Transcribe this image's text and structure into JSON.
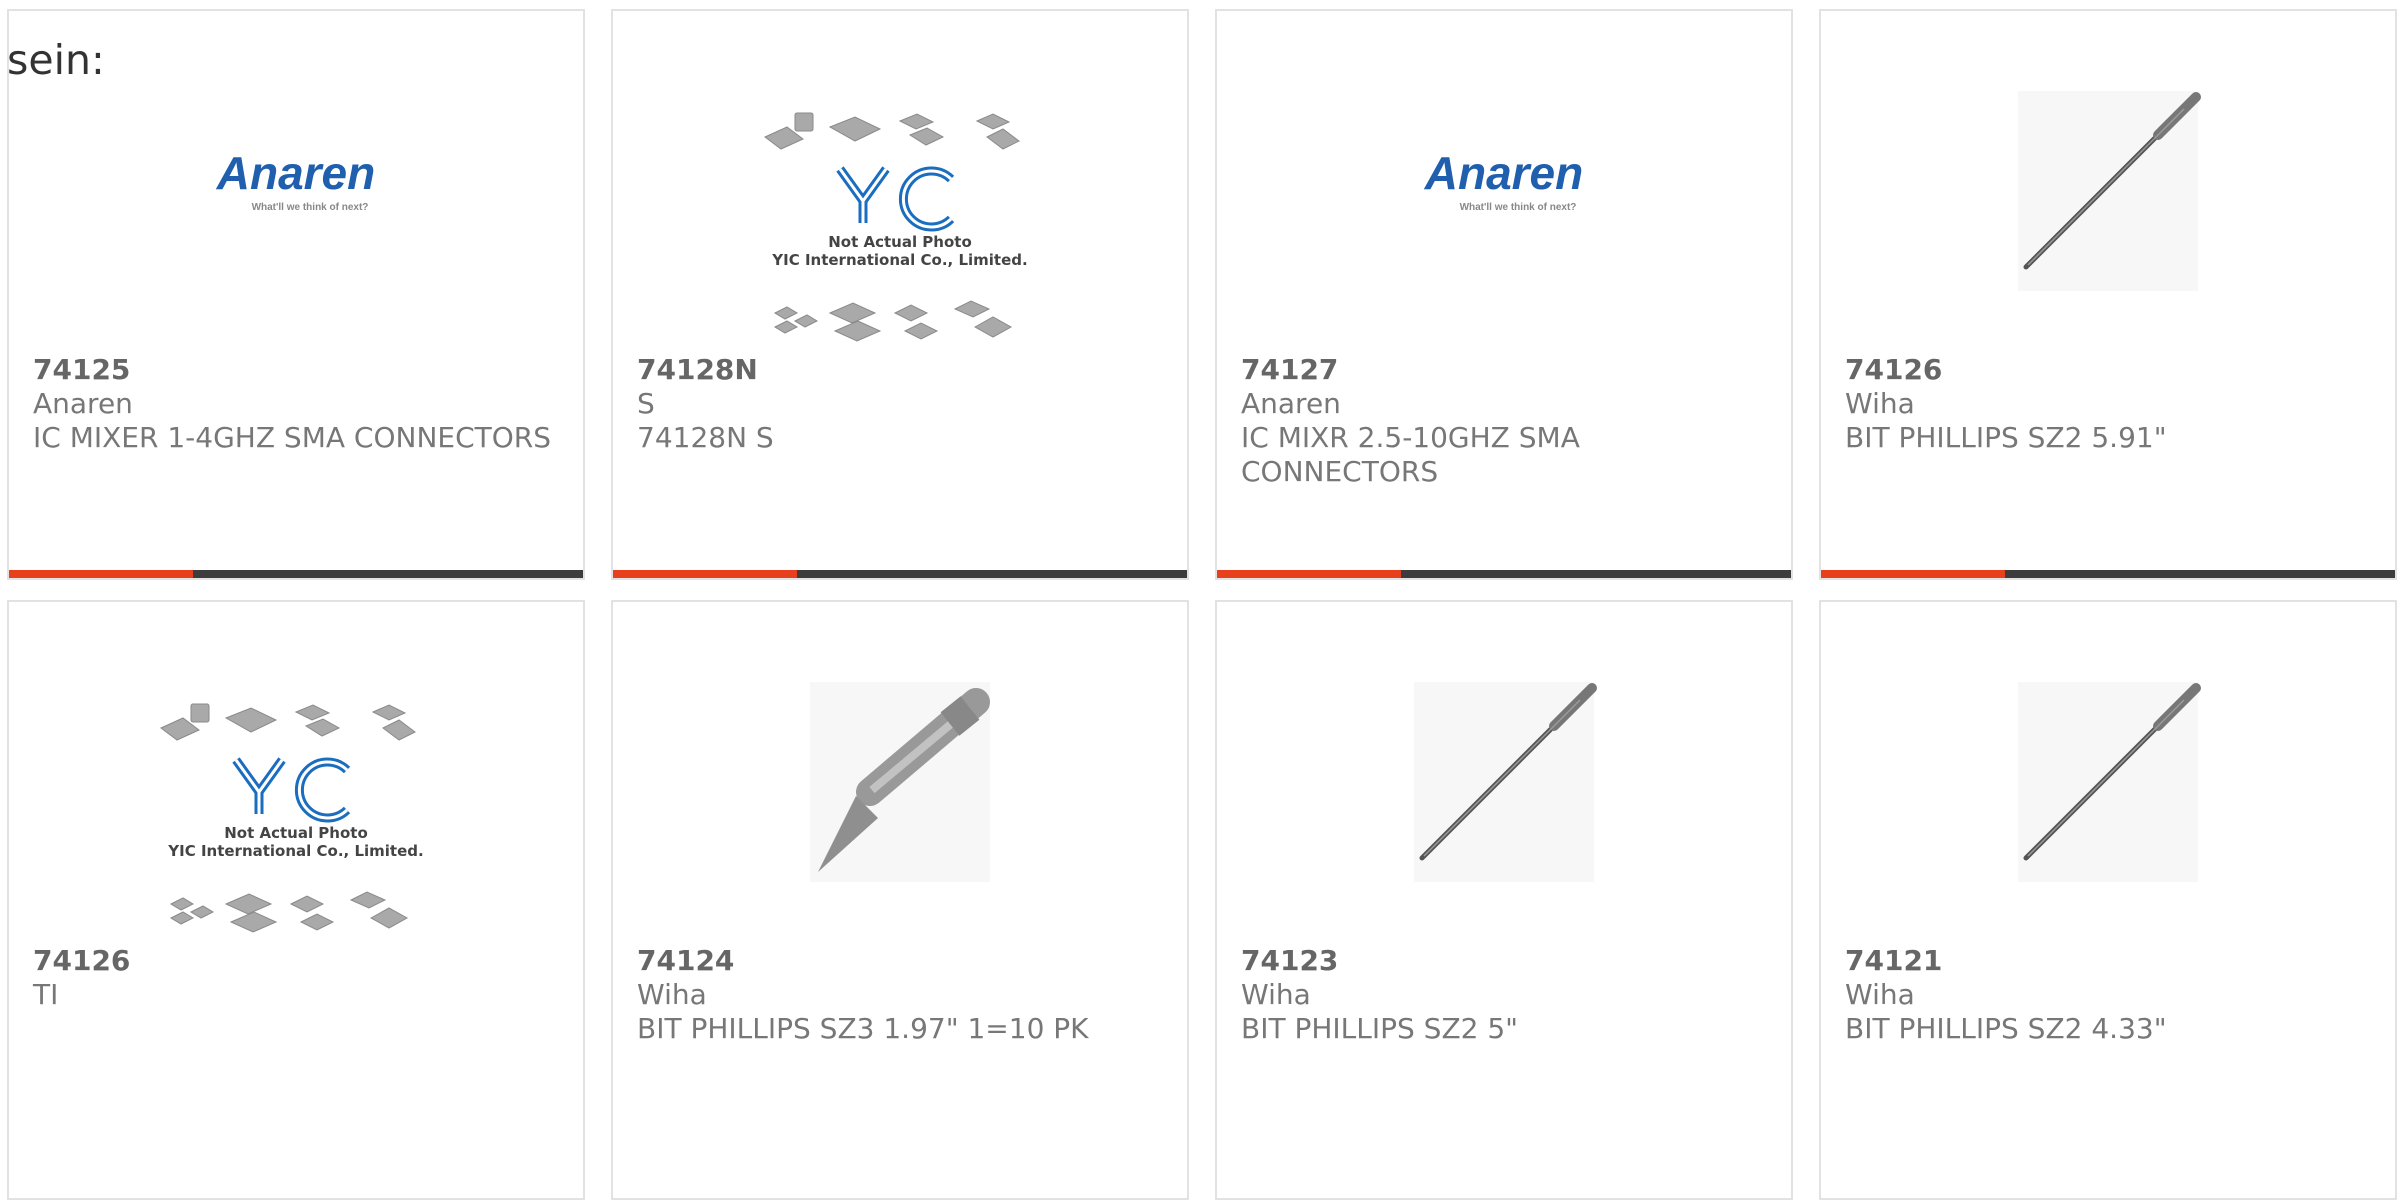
{
  "page": {
    "heading": "sein:"
  },
  "colors": {
    "accent": "#e8401c",
    "bar_track": "#3c3c3c",
    "anaren_blue": "#1f5fad",
    "yic_blue": "#1a6dbf"
  },
  "products": [
    {
      "part": "74125",
      "manufacturer": "Anaren",
      "description": "IC MIXER 1-4GHZ SMA CONNECTORS",
      "image": "anaren-logo",
      "logo_text": "Anaren",
      "logo_tagline": "What'll we think of next?",
      "progress": 0.32
    },
    {
      "part": "74128N",
      "manufacturer": "S",
      "description": "74128N S",
      "image": "yic-placeholder",
      "placeholder_line1": "Not Actual Photo",
      "placeholder_line2": "YIC International Co., Limited.",
      "progress": 0.32
    },
    {
      "part": "74127",
      "manufacturer": "Anaren",
      "description": "IC MIXR 2.5-10GHZ SMA CONNECTORS",
      "image": "anaren-logo",
      "logo_text": "Anaren",
      "logo_tagline": "What'll we think of next?",
      "progress": 0.32
    },
    {
      "part": "74126",
      "manufacturer": "Wiha",
      "description": "BIT PHILLIPS SZ2 5.91\"",
      "image": "long-bit",
      "progress": 0.32
    },
    {
      "part": "74126",
      "manufacturer": "TI",
      "description": "",
      "image": "yic-placeholder",
      "placeholder_line1": "Not Actual Photo",
      "placeholder_line2": "YIC International Co., Limited."
    },
    {
      "part": "74124",
      "manufacturer": "Wiha",
      "description": "BIT PHILLIPS SZ3 1.97\" 1=10 PK",
      "image": "short-bit"
    },
    {
      "part": "74123",
      "manufacturer": "Wiha",
      "description": "BIT PHILLIPS SZ2 5\"",
      "image": "long-bit"
    },
    {
      "part": "74121",
      "manufacturer": "Wiha",
      "description": "BIT PHILLIPS SZ2 4.33\"",
      "image": "long-bit"
    }
  ]
}
